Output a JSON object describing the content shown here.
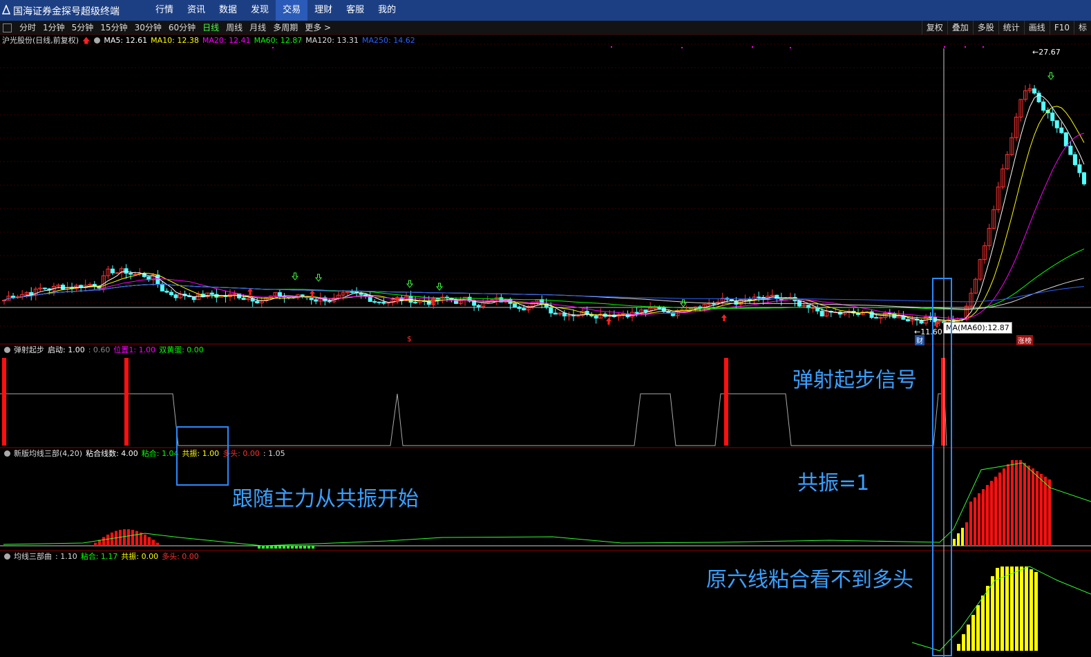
{
  "app": {
    "title": "国海证券金探号超级终端",
    "menu": [
      {
        "label": "行情",
        "active": false
      },
      {
        "label": "资讯",
        "active": false
      },
      {
        "label": "数据",
        "active": false
      },
      {
        "label": "发现",
        "active": false
      },
      {
        "label": "交易",
        "active": true
      },
      {
        "label": "理财",
        "active": false
      },
      {
        "label": "客服",
        "active": false
      },
      {
        "label": "我的",
        "active": false
      }
    ]
  },
  "toolbar": {
    "periods": [
      {
        "label": "分时",
        "active": false
      },
      {
        "label": "1分钟",
        "active": false
      },
      {
        "label": "5分钟",
        "active": false
      },
      {
        "label": "15分钟",
        "active": false
      },
      {
        "label": "30分钟",
        "active": false
      },
      {
        "label": "60分钟",
        "active": false
      },
      {
        "label": "日线",
        "active": true
      },
      {
        "label": "周线",
        "active": false
      },
      {
        "label": "月线",
        "active": false
      },
      {
        "label": "多周期",
        "active": false
      },
      {
        "label": "更多 >",
        "active": false
      }
    ],
    "right_buttons": [
      "复权",
      "叠加",
      "多股",
      "统计",
      "画线",
      "F10",
      "标"
    ]
  },
  "main_info": {
    "stock": "沪光股份(日线,前复权)",
    "ma5": "MA5: 12.61",
    "ma10": "MA10: 12.38",
    "ma20": "MA20: 12.41",
    "ma60": "MA60: 12.87",
    "ma120": "MA120: 13.31",
    "ma250": "MA250: 14.62"
  },
  "ind1_info": {
    "name": "弹射起步",
    "start": "启动: 1.00",
    "val": ": 0.60",
    "pos": "位置1: 1.00",
    "egg": "双黄蛋: 0.00"
  },
  "ind2_info": {
    "name": "新版均线三部(4,20)",
    "count": "粘合线数: 4.00",
    "stick": "粘合: 1.04",
    "reso": "共振: 1.00",
    "bull": "多头: 0.00",
    "val": ": 1.05"
  },
  "ind3_info": {
    "name": "均线三部曲",
    "val": ": 1.10",
    "stick": "粘合: 1.17",
    "reso": "共振: 0.00",
    "bull": "多头: 0.00"
  },
  "price_labels": {
    "high": "27.67",
    "low": "11.60",
    "tooltip": "MA(MA60):12.87",
    "tag_fin": "财",
    "tag_limit": "涨榜",
    "dollar": "$"
  },
  "annotations": {
    "signal": "弹射起步信号",
    "resonance": "共振=1",
    "follow": "跟随主力从共振开始",
    "original": "原六线粘合看不到多头"
  },
  "colors": {
    "up": "#ff3232",
    "down": "#54ffff",
    "ma5": "#ffffff",
    "ma10": "#ffff00",
    "ma20": "#ff00ff",
    "ma60": "#00ff00",
    "ma120": "#dddddd",
    "ma250": "#2a62ff",
    "annotation": "#3aa0ff"
  },
  "chart_data": {
    "type": "candlestick",
    "series_summary": {
      "price_low": 11.6,
      "price_high": 27.67
    },
    "indicators": [
      {
        "name": "弹射起步",
        "启动": 1.0,
        "value": 0.6,
        "位置1": 1.0,
        "双黄蛋": 0.0
      },
      {
        "name": "新版均线三部(4,20)",
        "粘合线数": 4.0,
        "粘合": 1.04,
        "共振": 1.0,
        "多头": 0.0,
        "value": 1.05
      },
      {
        "name": "均线三部曲",
        "value": 1.1,
        "粘合": 1.17,
        "共振": 0.0,
        "多头": 0.0
      }
    ]
  }
}
